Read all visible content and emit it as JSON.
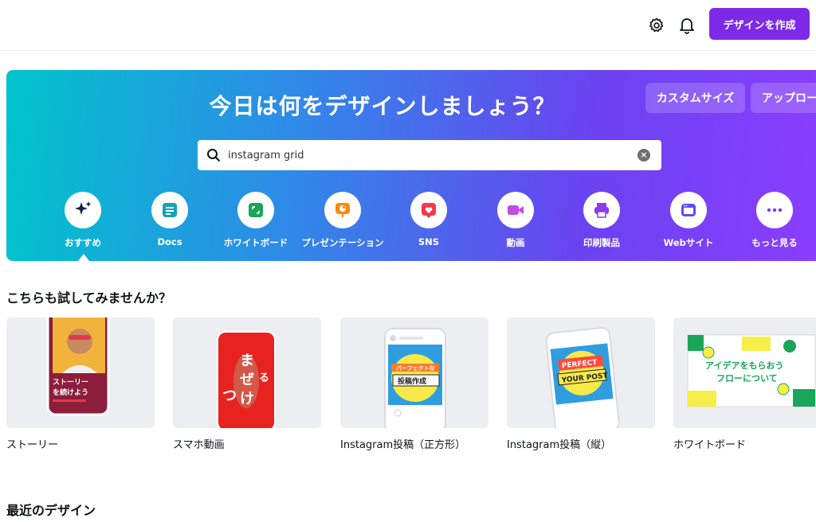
{
  "topbar": {
    "settings_icon": "gear-icon",
    "notifications_icon": "bell-icon",
    "create_button": "デザインを作成",
    "accent": "#7d2ae8"
  },
  "hero": {
    "title": "今日は何をデザインしましょう？",
    "custom_size_button": "カスタムサイズ",
    "upload_button": "アップロード",
    "search": {
      "value": "instagram grid",
      "icon": "search-icon",
      "clear_icon": "clear-icon"
    },
    "categories": [
      {
        "label": "おすすめ",
        "icon": "sparkle-icon",
        "color": "#1a1f4b"
      },
      {
        "label": "Docs",
        "icon": "docs-icon",
        "color": "#13a3b5"
      },
      {
        "label": "ホワイトボード",
        "icon": "whiteboard-icon",
        "color": "#1aa55a"
      },
      {
        "label": "プレゼンテーション",
        "icon": "presentation-icon",
        "color": "#ff8a00"
      },
      {
        "label": "SNS",
        "icon": "heart-icon",
        "color": "#f23a4d"
      },
      {
        "label": "動画",
        "icon": "video-icon",
        "color": "#c04ce0"
      },
      {
        "label": "印刷製品",
        "icon": "printer-icon",
        "color": "#8e3bf0"
      },
      {
        "label": "Webサイト",
        "icon": "website-icon",
        "color": "#5d4cf2"
      },
      {
        "label": "もっと見る",
        "icon": "more-icon",
        "color": "#7a3cf0"
      }
    ]
  },
  "suggestions": {
    "title": "こちらも試してみませんか？",
    "cards": [
      {
        "label": "ストーリー",
        "overlay_text": "ストーリーを続けよう"
      },
      {
        "label": "スマホ動画",
        "overlay_text": "まぜるつけ"
      },
      {
        "label": "Instagram投稿（正方形）",
        "overlay_text": "パーフェクトな投稿作成"
      },
      {
        "label": "Instagram投稿（縦）",
        "overlay_text": "PERFECT YOUR POST"
      },
      {
        "label": "ホワイトボード",
        "overlay_text": "アイデアをもらおうフローについて"
      }
    ]
  },
  "recent": {
    "title": "最近のデザイン"
  }
}
